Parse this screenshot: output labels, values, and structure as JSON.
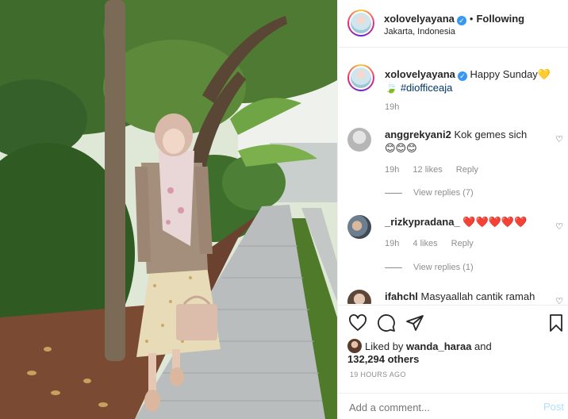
{
  "post": {
    "author": "xolovelyayana",
    "follow_status": "Following",
    "location": "Jakarta, Indonesia",
    "photo_description": "Woman in hijab, beige cardigan and floral skirt standing on a garden brick path",
    "photo_alt": "photo-of-woman-on-garden-path"
  },
  "caption": {
    "author": "xolovelyayana",
    "text": "Happy Sunday💛",
    "hashtag": "#diofficeaja",
    "leaf": "🍃",
    "time": "19h"
  },
  "comments": [
    {
      "user": "anggrekyani2",
      "text": "Kok gemes sich",
      "emoji": "😊😊😊",
      "time": "19h",
      "likes": "12 likes",
      "reply": "Reply",
      "view_replies": "View replies (7)"
    },
    {
      "user": "_rizkypradana_",
      "text": "❤️❤️❤️❤️❤️",
      "time": "19h",
      "likes": "4 likes",
      "reply": "Reply",
      "view_replies": "View replies (1)"
    },
    {
      "user": "ifahchl",
      "text": "Masyaallah cantik ramah"
    }
  ],
  "likes": {
    "prefix": "Liked by",
    "user": "wanda_haraa",
    "and": "and",
    "others": "132,294 others"
  },
  "timestamp": "19 HOURS AGO",
  "add_comment": {
    "placeholder": "Add a comment...",
    "post_label": "Post"
  },
  "icons": {
    "like": "heart-icon",
    "comment": "comment-icon",
    "share": "paper-plane-icon",
    "save": "bookmark-icon",
    "verified": "verified-badge-icon"
  },
  "colors": {
    "verified": "#3897f0",
    "heart_red": "#ed4956",
    "hashtag": "#00376b",
    "muted": "#8e8e8e",
    "post_disabled": "#b2dffc"
  }
}
